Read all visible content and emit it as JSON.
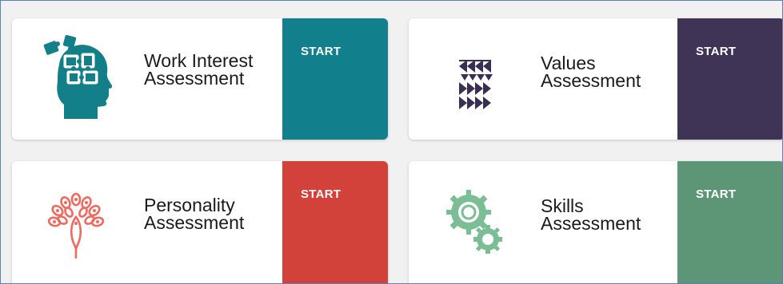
{
  "cards": [
    {
      "title_line1": "Work Interest",
      "title_line2": "Assessment",
      "button_label": "START",
      "button_color": "#12808c",
      "icon": "head-puzzle-icon",
      "icon_color": "#137f88"
    },
    {
      "title_line1": "Values",
      "title_line2": "Assessment",
      "button_label": "START",
      "button_color": "#3f3456",
      "icon": "chevrons-icon",
      "icon_color": "#3a2f52"
    },
    {
      "title_line1": "Personality",
      "title_line2": "Assessment",
      "button_label": "START",
      "button_color": "#d2423a",
      "icon": "peacock-icon",
      "icon_color": "#ee6a5f"
    },
    {
      "title_line1": "Skills",
      "title_line2": "Assessment",
      "button_label": "START",
      "button_color": "#5d9676",
      "icon": "gears-icon",
      "icon_color": "#7bbd94"
    }
  ]
}
